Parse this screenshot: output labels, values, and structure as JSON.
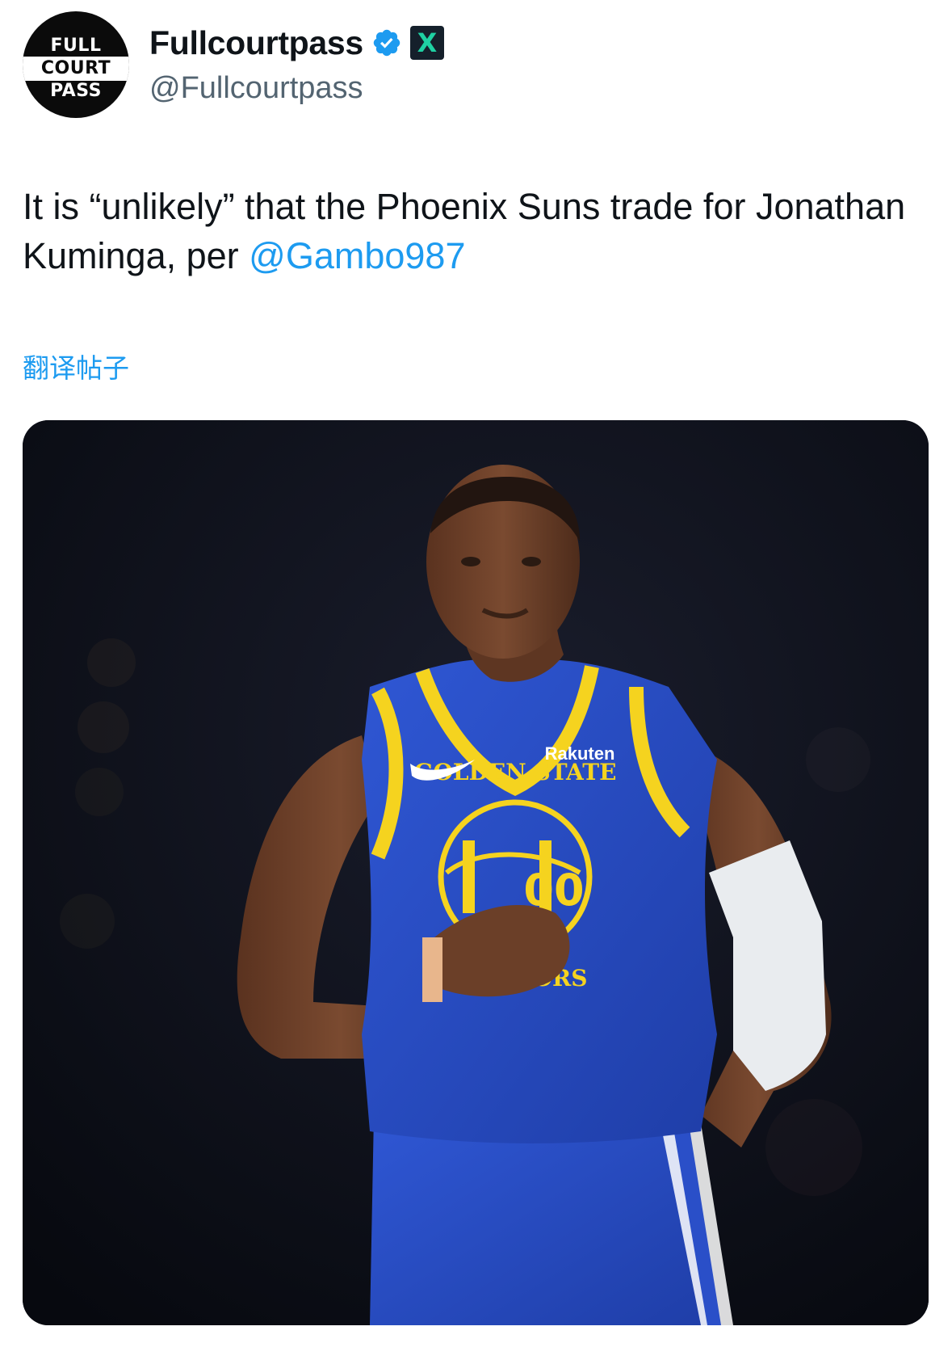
{
  "user": {
    "display_name": "Fullcourtpass",
    "handle": "@Fullcourtpass",
    "avatar_lines": [
      "FULL",
      "COURT",
      "PASS"
    ],
    "verified_icon": "verified-badge-icon",
    "affiliate_icon": "x-logo-icon",
    "affiliate_glyph": "X"
  },
  "tweet": {
    "text_before": "It is “unlikely” that the Phoenix Suns trade for Jonathan Kuminga, per ",
    "mention": "@Gambo987",
    "translate_label": "翻译帖子"
  },
  "media": {
    "jersey_text": [
      "GOLDEN STATE",
      "WARRIORS"
    ],
    "jersey_number": "00",
    "sponsor": "Rakuten",
    "colors": {
      "jersey_blue": "#2a4fc8",
      "trim_yellow": "#f5d31f",
      "skin": "#6b3f28",
      "background": "#0a0d18"
    }
  },
  "colors": {
    "link": "#1d9bf0",
    "text": "#0f1419",
    "secondary": "#536471"
  }
}
